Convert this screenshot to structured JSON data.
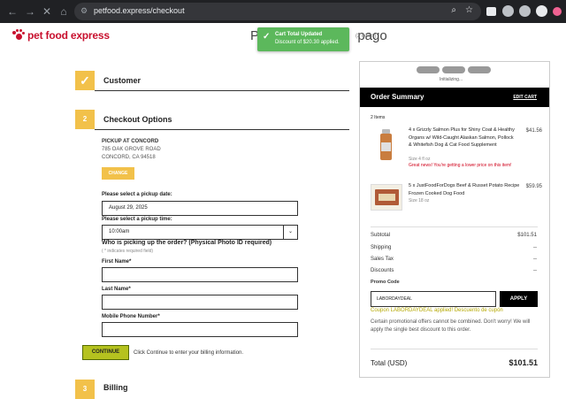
{
  "browser": {
    "url": "petfood.express/checkout"
  },
  "header": {
    "logo_text": "pet food express",
    "page_title": "Pro",
    "page_title_tail": "pago",
    "items_count": "(2 items)"
  },
  "toast": {
    "title": "Cart Total Updated",
    "message": "Discount of $20.30 applied."
  },
  "steps": {
    "customer": {
      "number": "",
      "title": "Customer"
    },
    "checkout_options": {
      "number": "2",
      "title": "Checkout Options"
    },
    "next": {
      "number": "3",
      "title": "Billing"
    }
  },
  "pickup": {
    "store_name": "PICKUP AT CONCORD",
    "address1": "785 OAK GROVE ROAD",
    "address2": "CONCORD, CA 94518",
    "change_label": "CHANGE",
    "date_label": "Please select a pickup date:",
    "date_value": "August 29, 2025",
    "time_label": "Please select a pickup time:",
    "time_value": "10:00am",
    "who_heading": "Who is picking up the order? (Physical Photo ID required)",
    "required_note": "( * indicates required field)",
    "first_name_label": "First Name*",
    "last_name_label": "Last Name*",
    "phone_label": "Mobile Phone Number*",
    "continue_label": "CONTINUE",
    "continue_hint": "Click Continue to enter your billing information."
  },
  "summary": {
    "initializing": "Initializing...",
    "title": "Order Summary",
    "edit_cart": "EDIT CART",
    "items_count": "2 Items",
    "items": [
      {
        "name": "4 x Grizzly Salmon Plus for Shiny Coat & Healthy Organs w/ Wild-Caught Alaskan Salmon, Pollock & Whitefish Dog & Cat Food Supplement",
        "size": "Size 4 fl oz",
        "promo": "Great news! You're getting a lower price on this item!",
        "price": "$41.56"
      },
      {
        "name": "5 x JustFoodForDogs Beef & Russet Potato Recipe Frozen Cooked Dog Food",
        "size": "Size 18 oz",
        "price": "$59.95"
      }
    ],
    "subtotal_label": "Subtotal",
    "subtotal_value": "$101.51",
    "shipping_label": "Shipping",
    "shipping_value": "--",
    "tax_label": "Sales Tax",
    "tax_value": "--",
    "discounts_label": "Discounts",
    "discounts_value": "--",
    "promo_label": "Promo Code",
    "promo_value": "LABORDAYDEAL",
    "apply_label": "APPLY",
    "promo_applied": "Coupon LABORDAYDEAL applied! Descuento de cupón",
    "promo_note": "Certain promotional offers cannot be combined. Don't worry! We will apply the single best discount to this order.",
    "total_label": "Total (USD)",
    "total_value": "$101.51"
  },
  "colors": {
    "brand_red": "#c8102e",
    "step_yellow": "#f2c14a",
    "toast_green": "#5cb85c",
    "promo_red": "#d0021b",
    "continue_green": "#b5c21f"
  }
}
